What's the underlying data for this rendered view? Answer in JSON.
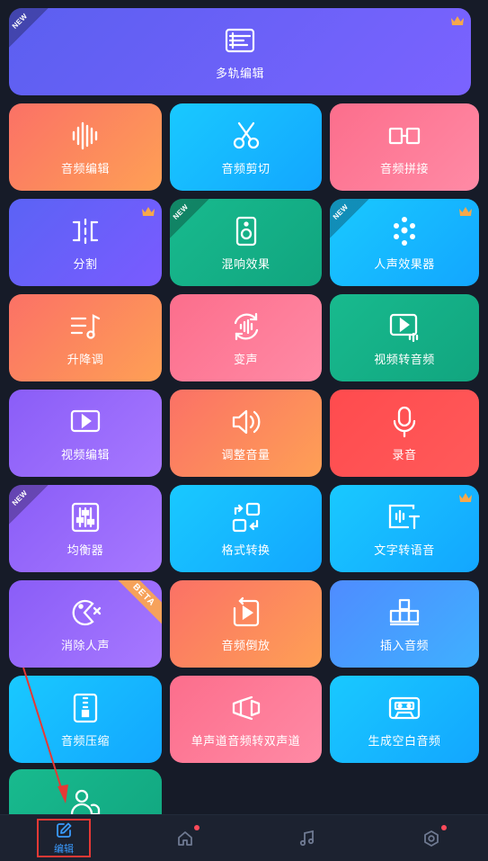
{
  "tiles": {
    "multitrack": {
      "label": "多轨编辑",
      "badge": "NEW"
    },
    "audio_edit": {
      "label": "音频编辑"
    },
    "audio_cut": {
      "label": "音频剪切"
    },
    "audio_join": {
      "label": "音频拼接"
    },
    "split": {
      "label": "分割"
    },
    "reverb": {
      "label": "混响效果",
      "badge": "NEW"
    },
    "voice_effects": {
      "label": "人声效果器",
      "badge": "NEW"
    },
    "pitch": {
      "label": "升降调"
    },
    "voice_change": {
      "label": "变声"
    },
    "video_to_audio": {
      "label": "视频转音频"
    },
    "video_edit": {
      "label": "视频编辑"
    },
    "volume": {
      "label": "调整音量"
    },
    "record": {
      "label": "录音"
    },
    "equalizer": {
      "label": "均衡器",
      "badge": "NEW"
    },
    "format_convert": {
      "label": "格式转换"
    },
    "text_to_speech": {
      "label": "文字转语音"
    },
    "remove_vocals": {
      "label": "消除人声",
      "badge": "BETA"
    },
    "reverse": {
      "label": "音频倒放"
    },
    "insert_audio": {
      "label": "插入音频"
    },
    "compress": {
      "label": "音频压缩"
    },
    "mono_to_stereo": {
      "label": "单声道音频转双声道"
    },
    "blank_audio": {
      "label": "生成空白音频"
    }
  },
  "bottom_nav": {
    "edit_label": "编辑"
  },
  "colors": {
    "accent": "#3a9bff",
    "notification_dot": "#ff4a5a",
    "annotation": "#e53935",
    "crown": "#f7a84a"
  }
}
